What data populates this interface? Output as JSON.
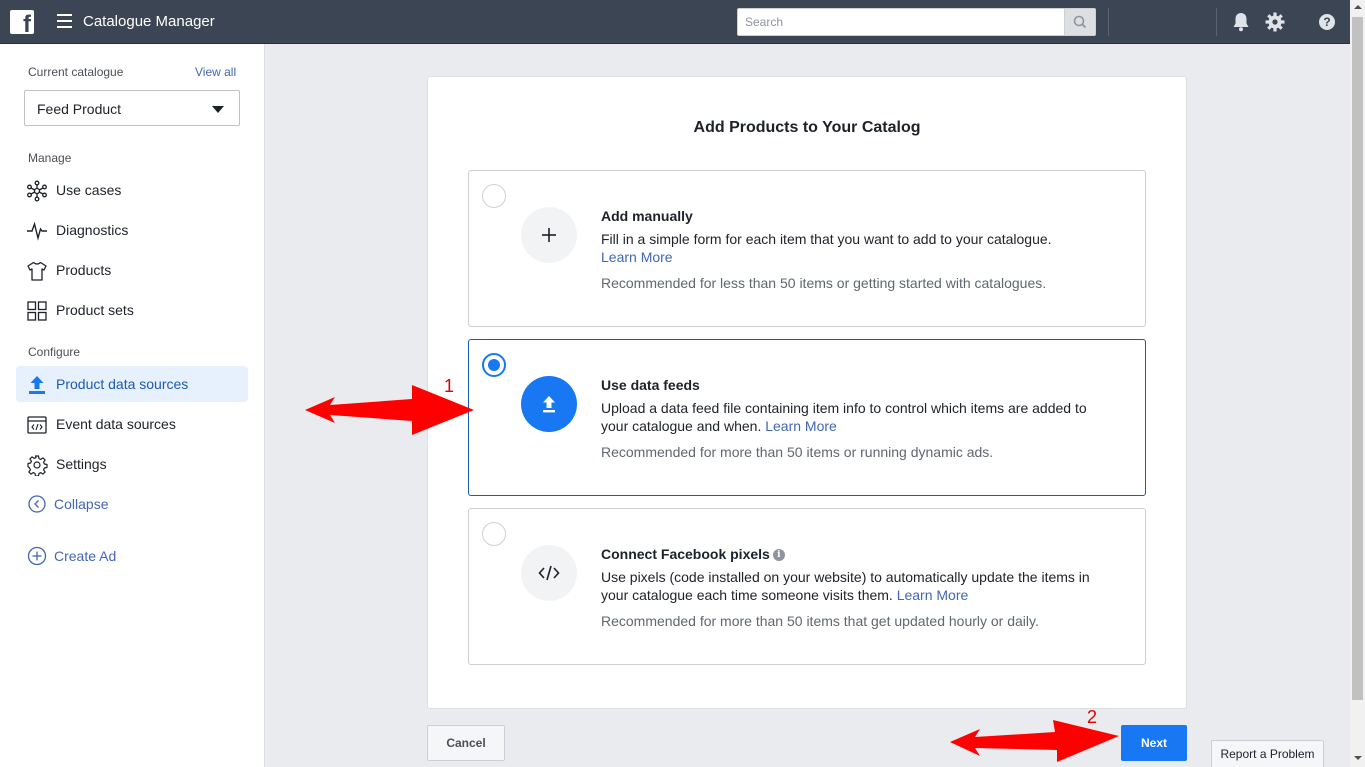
{
  "header": {
    "app_title": "Catalogue Manager",
    "search_placeholder": "Search",
    "icons": [
      "facebook-logo",
      "menu-icon",
      "search-icon",
      "bell-icon",
      "gear-icon",
      "help-icon"
    ]
  },
  "sidebar": {
    "current_catalogue_label": "Current catalogue",
    "view_all": "View all",
    "catalogue_value": "Feed Product",
    "manage_label": "Manage",
    "manage_items": [
      {
        "label": "Use cases",
        "icon": "use-cases-icon"
      },
      {
        "label": "Diagnostics",
        "icon": "pulse-icon"
      },
      {
        "label": "Products",
        "icon": "shirt-icon"
      },
      {
        "label": "Product sets",
        "icon": "grid-icon"
      }
    ],
    "configure_label": "Configure",
    "configure_items": [
      {
        "label": "Product data sources",
        "icon": "upload-icon",
        "active": true
      },
      {
        "label": "Event data sources",
        "icon": "code-window-icon"
      },
      {
        "label": "Settings",
        "icon": "gear-icon"
      }
    ],
    "collapse": "Collapse",
    "create_ad": "Create Ad"
  },
  "main": {
    "title": "Add Products to Your Catalog",
    "options": [
      {
        "title": "Add manually",
        "description": "Fill in a simple form for each item that you want to add to your catalogue.",
        "link": "Learn More",
        "note": "Recommended for less than 50 items or getting started with catalogues.",
        "icon": "plus-icon",
        "selected": false
      },
      {
        "title": "Use data feeds",
        "description": "Upload a data feed file containing item info to control which items are added to your catalogue and when.",
        "link": "Learn More",
        "note": "Recommended for more than 50 items or running dynamic ads.",
        "icon": "upload-icon",
        "selected": true
      },
      {
        "title": "Connect Facebook pixels",
        "description": "Use pixels (code installed on your website) to automatically update the items in your catalogue each time someone visits them.",
        "link": "Learn More",
        "note": "Recommended for more than 50 items that get updated hourly or daily.",
        "icon": "code-icon",
        "selected": false
      }
    ],
    "cancel": "Cancel",
    "next": "Next"
  },
  "report_problem": "Report a Problem",
  "annotations": [
    {
      "number": "1",
      "color": "#e00000"
    },
    {
      "number": "2",
      "color": "#e00000"
    }
  ],
  "colors": {
    "topbar": "#3b4553",
    "accent": "#1877f2",
    "link": "#4267b2",
    "annotation": "#ff0000"
  }
}
